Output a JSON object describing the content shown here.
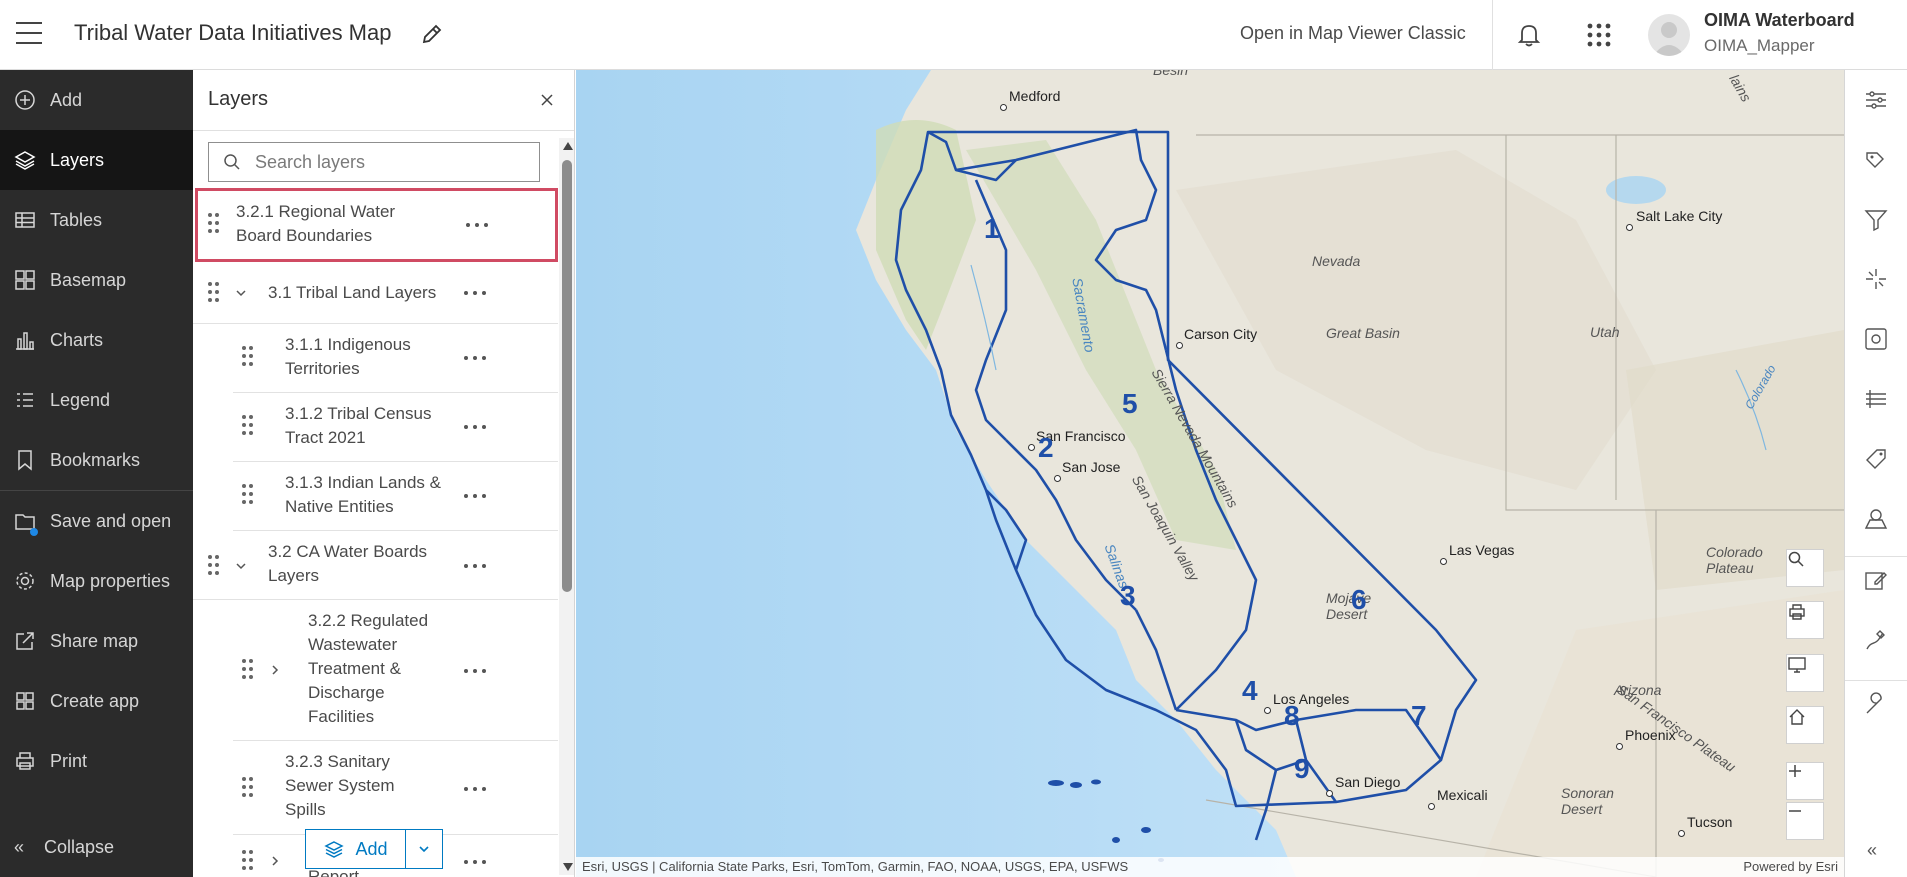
{
  "header": {
    "title": "Tribal Water Data Initiatives Map",
    "open_classic": "Open in Map Viewer Classic",
    "user_name": "OIMA Waterboard",
    "user_role": "OIMA_Mapper"
  },
  "sidenav": {
    "items": [
      {
        "label": "Add",
        "icon": "add-icon"
      },
      {
        "label": "Layers",
        "icon": "layers-icon",
        "active": true
      },
      {
        "label": "Tables",
        "icon": "tables-icon"
      },
      {
        "label": "Basemap",
        "icon": "basemap-icon"
      },
      {
        "label": "Charts",
        "icon": "charts-icon"
      },
      {
        "label": "Legend",
        "icon": "legend-icon"
      },
      {
        "label": "Bookmarks",
        "icon": "bookmark-icon"
      },
      {
        "label": "Save and open",
        "icon": "save-icon"
      },
      {
        "label": "Map properties",
        "icon": "gear-icon"
      },
      {
        "label": "Share map",
        "icon": "share-icon"
      },
      {
        "label": "Create app",
        "icon": "apps-icon"
      },
      {
        "label": "Print",
        "icon": "print-icon"
      }
    ],
    "collapse": "Collapse"
  },
  "layers": {
    "title": "Layers",
    "search_placeholder": "Search layers",
    "rows": [
      {
        "label": "3.2.1 Regional Water Board Boundaries"
      },
      {
        "label": "3.1 Tribal Land Layers"
      },
      {
        "label": "3.1.1 Indigenous Territories"
      },
      {
        "label": "3.1.2 Tribal Census Tract 2021"
      },
      {
        "label": "3.1.3 Indian Lands & Native Entities"
      },
      {
        "label": "3.2 CA Water Boards Layers"
      },
      {
        "label": "3.2.2 Regulated Wastewater Treatment & Discharge Facilities"
      },
      {
        "label": "3.2.3 Sanitary Sewer System Spills"
      },
      {
        "label": "Report"
      }
    ],
    "add_button": "Add"
  },
  "map": {
    "attribution": "Esri, USGS | California State Parks, Esri, TomTom, Garmin, FAO, NOAA, USGS, EPA, USFWS",
    "powered_by": "Powered by Esri",
    "cities": [
      "Medford",
      "Salt Lake City",
      "Carson City",
      "San Francisco",
      "San Jose",
      "Las Vegas",
      "Los Angeles",
      "San Diego",
      "Mexicali",
      "Phoenix",
      "Tucson"
    ],
    "regions": [
      "Nevada",
      "Great Basin",
      "Utah",
      "Sacramento",
      "Sierra Nevada Mountains",
      "San Joaquin Valley",
      "Salinas",
      "Mojave Desert",
      "Colorado Plateau",
      "San Francisco Plateau",
      "Arizona",
      "Sonoran Desert",
      "Colorado",
      "lains",
      "Besin"
    ],
    "board_numbers": [
      "1",
      "2",
      "3",
      "4",
      "5",
      "6",
      "7",
      "8",
      "9"
    ]
  }
}
